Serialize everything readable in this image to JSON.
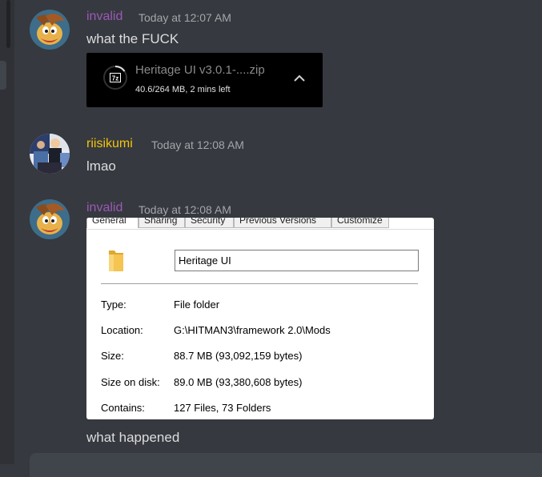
{
  "colors": {
    "username_invalid": "#9b59b6",
    "username_riisikumi": "#f1c40f",
    "background": "#36393f"
  },
  "messages": [
    {
      "username": "invalid",
      "timestamp": "Today at 12:07 AM",
      "text": "what the FUCK",
      "avatar": "rayman-avatar"
    },
    {
      "username": "riisikumi",
      "timestamp": "Today at 12:08 AM",
      "text": "lmao",
      "avatar": "collage-avatar"
    },
    {
      "username": "invalid",
      "timestamp": "Today at 12:08 AM",
      "text": "what happened",
      "avatar": "rayman-avatar"
    }
  ],
  "download": {
    "filename": "Heritage UI v3.0.1-....zip",
    "status": "40.6/264 MB, 2 mins left",
    "icon": "7zip-icon",
    "progress_fraction": 0.154
  },
  "properties": {
    "tabs": [
      "General",
      "Sharing",
      "Security",
      "Previous Versions",
      "Customize"
    ],
    "name_value": "Heritage UI",
    "rows": [
      {
        "label": "Type:",
        "value": "File folder"
      },
      {
        "label": "Location:",
        "value": "G:\\HITMAN3\\framework 2.0\\Mods"
      },
      {
        "label": "Size:",
        "value": "88.7 MB (93,092,159 bytes)"
      },
      {
        "label": "Size on disk:",
        "value": "89.0 MB (93,380,608 bytes)"
      },
      {
        "label": "Contains:",
        "value": "127 Files, 73 Folders"
      }
    ]
  }
}
